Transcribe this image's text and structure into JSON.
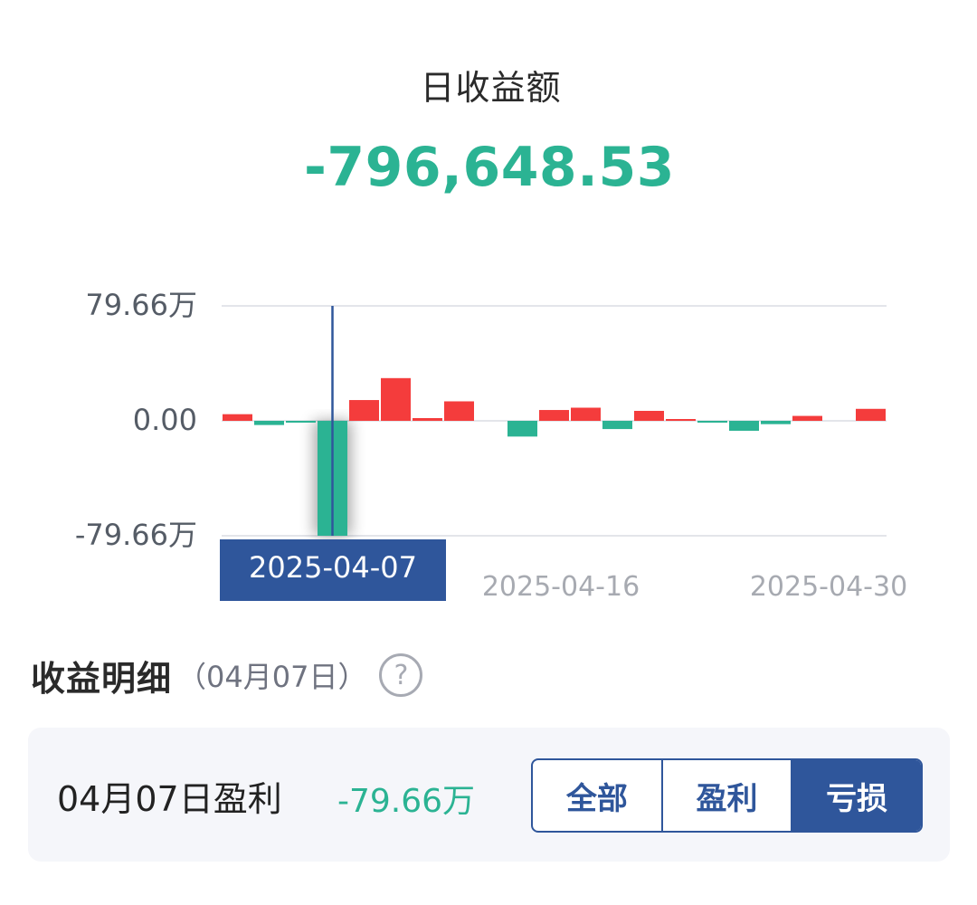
{
  "header": {
    "title": "日收益额",
    "amount": "-796,648.53"
  },
  "colors": {
    "profit": "#f43c3c",
    "loss": "#2bb393",
    "accent": "#2f569b"
  },
  "chart_data": {
    "type": "bar",
    "y_ticks": [
      "79.66万",
      "0.00",
      "-79.66万"
    ],
    "ylim": [
      -79.66,
      79.66
    ],
    "y_unit": "万",
    "x_ticks": [
      "2025-04-16",
      "2025-04-30"
    ],
    "x": [
      "2025-04-01",
      "2025-04-02",
      "2025-04-03",
      "2025-04-07",
      "2025-04-08",
      "2025-04-09",
      "2025-04-10",
      "2025-04-11",
      "2025-04-14",
      "2025-04-15",
      "2025-04-16",
      "2025-04-17",
      "2025-04-18",
      "2025-04-21",
      "2025-04-22",
      "2025-04-23",
      "2025-04-24",
      "2025-04-25",
      "2025-04-28",
      "2025-04-29",
      "2025-04-30"
    ],
    "values": [
      4.6,
      -2.9,
      -0.6,
      -79.66,
      14.4,
      29.6,
      1.9,
      13.5,
      0,
      -10.9,
      7.5,
      9.1,
      -5.7,
      6.9,
      0.3,
      -1.2,
      -6.9,
      -2.3,
      3.4,
      0,
      8.3
    ],
    "highlight_index": 3,
    "selected_label": "2025-04-07",
    "grid": true
  },
  "detail": {
    "title": "收益明细",
    "date_label": "（04月07日）",
    "help_icon": "question-circle-icon",
    "row_label": "04月07日盈利",
    "row_value": "-79.66万",
    "filters": [
      "全部",
      "盈利",
      "亏损"
    ],
    "active_filter": 2
  }
}
